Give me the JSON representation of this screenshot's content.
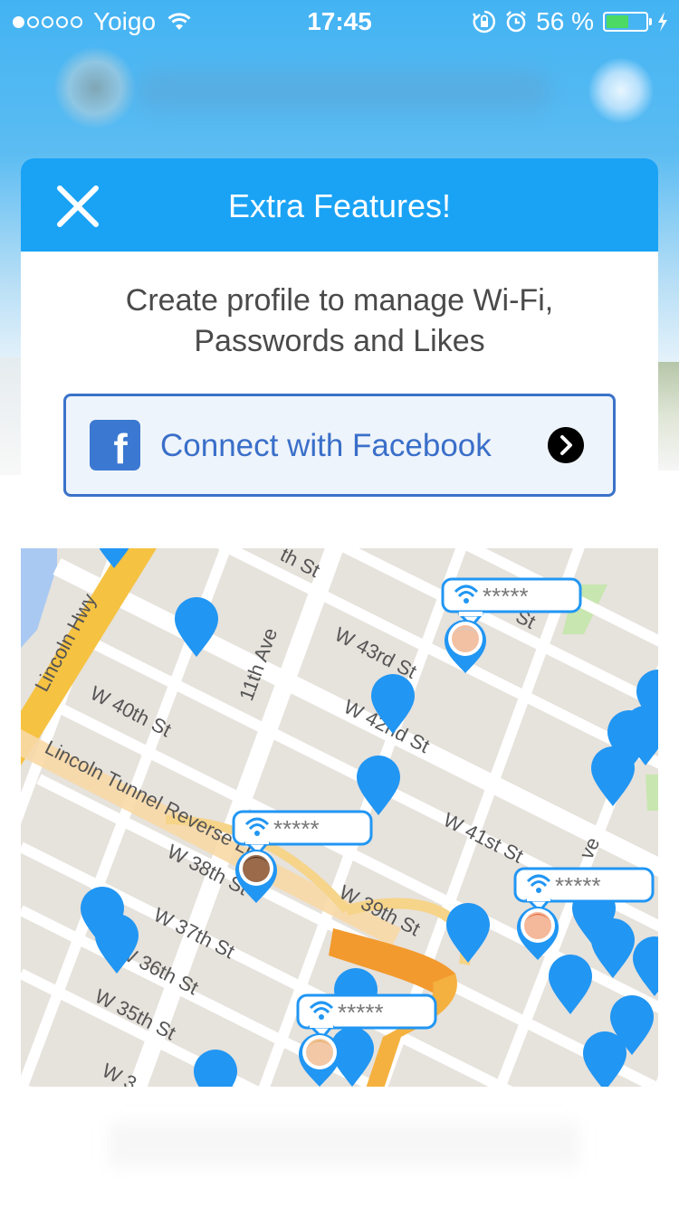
{
  "status_bar": {
    "carrier": "Yoigo",
    "time": "17:45",
    "battery_percent": "56 %",
    "battery_level": 0.56,
    "signal_bars_filled": 1,
    "signal_bars_total": 5
  },
  "modal": {
    "title": "Extra Features!",
    "close_icon": "close-icon",
    "description_line1": "Create profile to manage Wi-Fi,",
    "description_line2": "Passwords and Likes",
    "facebook_button": {
      "label": "Connect with Facebook",
      "icon": "facebook-icon",
      "arrow_icon": "chevron-right-icon"
    }
  },
  "map": {
    "street_labels": [
      "Lincoln Hwy",
      "W 40th St",
      "Lincoln Tunnel Reverse Ln",
      "11th Ave",
      "W 43rd St",
      "W 42nd St",
      "W 41st St",
      "W 38th St",
      "W 37th St",
      "W 36th St",
      "W 35th St",
      "W 39th St",
      "W 3",
      "th St",
      "St",
      "ve"
    ],
    "wifi_bubble_text": "*****",
    "colors": {
      "pin": "#2196f3",
      "road_major": "#f5c242",
      "water": "#a9c9f2"
    }
  },
  "colors": {
    "header": "#1aa3f5",
    "facebook_blue": "#3b78d1",
    "button_border": "#3a72c9"
  }
}
